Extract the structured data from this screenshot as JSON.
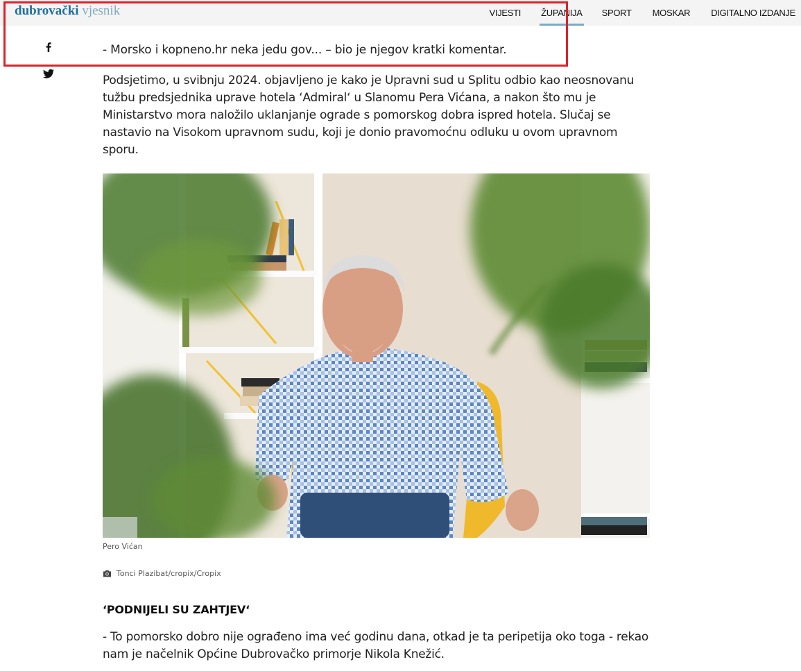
{
  "header": {
    "logo_part1": "dubrovački",
    "logo_part2": "vjesnik",
    "nav": [
      {
        "label": "VIJESTI",
        "active": false
      },
      {
        "label": "ŽUPANIJA",
        "active": true
      },
      {
        "label": "SPORT",
        "active": false
      },
      {
        "label": "MOSKAR",
        "active": false
      },
      {
        "label": "DIGITALNO IZDANJE",
        "active": false
      }
    ]
  },
  "social": {
    "facebook_icon": "facebook-icon",
    "twitter_icon": "twitter-icon"
  },
  "article": {
    "quote": "- Morsko i kopneno.hr neka jedu gov... – bio je njegov kratki komentar.",
    "paragraph": "Podsjetimo, u svibnju 2024. objavljeno je kako je Upravni sud u Splitu odbio kao neosnovanu tužbu predsjednika uprave hotela ‘Admiral‘ u Slanomu Pera Vićana, a nakon što mu je Ministarstvo mora naložilo uklanjanje ograde s pomorskog dobra ispred hotela. Slučaj se nastavio na Visokom upravnom sudu, koji je donio pravomoćnu odluku u ovom upravnom sporu.",
    "image_caption": "Pero Vićan",
    "image_credit": "Tonci Plazibat/cropix/Cropix",
    "credit_icon": "camera-icon",
    "subheading": "‘PODNIJELI SU ZAHTJEV‘",
    "last_paragraph": "- To pomorsko dobro nije ograđeno ima već godinu dana, otkad je ta peripetija oko toga - rekao nam je načelnik Općine Dubrovačko primorje Nikola Knežić."
  },
  "colors": {
    "brand": "#1e6f9c",
    "brand_light": "#7fa9c2",
    "highlight": "#d8232a",
    "topbar_bg": "#f4f4f4"
  }
}
